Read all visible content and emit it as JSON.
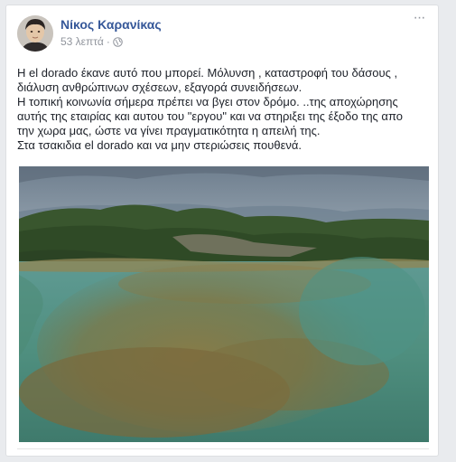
{
  "post": {
    "author": "Νίκος Καρανίκας",
    "time": "53 λεπτά",
    "separator": "·",
    "menu_label": "···",
    "lines": [
      "Η el dorado έκανε αυτό που μπορεί. Μόλυνση , καταστροφή του δάσους ,",
      "διάλυση ανθρώπινων σχέσεων, εξαγορά συνειδήσεων.",
      "Η τοπική κοινωνία σήμερα πρέπει να βγει στον δρόμο. ..της αποχώρησης",
      "αυτής της εταιρίας και αυτου του \"εργου\" και να στηριξει της έξοδο της απο",
      "την χωρα μας, ώστε να γίνει πραγματικότητα η απειλή της.",
      "Στα τσακιδια el dorado και να μην στεριώσεις πουθενά."
    ]
  },
  "colors": {
    "author_link": "#365899",
    "meta_text": "#90949c",
    "body_text": "#1d2129",
    "card_border": "#dddfe2",
    "page_bg": "#e9ebee"
  },
  "icons": {
    "avatar": "profile-photo",
    "privacy": "globe-icon",
    "options": "more-options-icon"
  }
}
